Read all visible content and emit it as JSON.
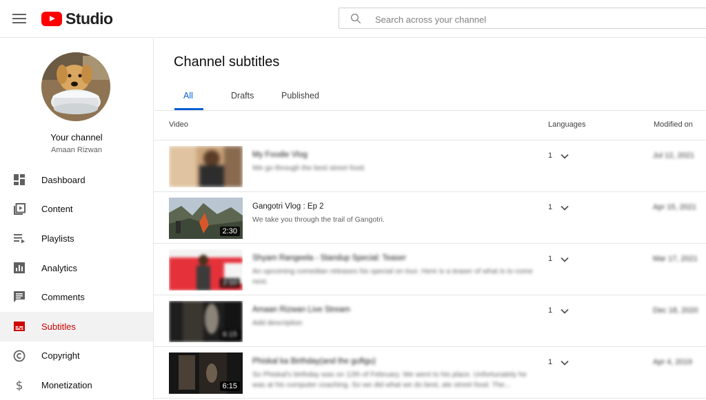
{
  "header": {
    "app_name": "Studio",
    "search_placeholder": "Search across your channel"
  },
  "sidebar": {
    "channel_title": "Your channel",
    "channel_name": "Amaan Rizwan",
    "items": [
      {
        "label": "Dashboard",
        "icon": "dashboard-icon"
      },
      {
        "label": "Content",
        "icon": "content-icon"
      },
      {
        "label": "Playlists",
        "icon": "playlists-icon"
      },
      {
        "label": "Analytics",
        "icon": "analytics-icon"
      },
      {
        "label": "Comments",
        "icon": "comments-icon"
      },
      {
        "label": "Subtitles",
        "icon": "subtitles-icon",
        "active": true
      },
      {
        "label": "Copyright",
        "icon": "copyright-icon"
      },
      {
        "label": "Monetization",
        "icon": "monetization-icon"
      }
    ]
  },
  "main": {
    "title": "Channel subtitles",
    "tabs": [
      {
        "label": "All",
        "active": true
      },
      {
        "label": "Drafts"
      },
      {
        "label": "Published"
      }
    ],
    "columns": {
      "video": "Video",
      "languages": "Languages",
      "modified": "Modified on"
    },
    "rows": [
      {
        "title": "My Foodie Vlog",
        "description": "We go through the best street food.",
        "duration": "",
        "languages": "1",
        "modified": "Jul 12, 2021",
        "blurred": true
      },
      {
        "title": "Gangotri Vlog : Ep 2",
        "description": "We take you through the trail of Gangotri.",
        "duration": "2:30",
        "languages": "1",
        "modified": "Apr 15, 2021",
        "blurred": false
      },
      {
        "title": "Shyam Rangeela - Standup Special: Teaser",
        "description": "An upcoming comedian releases his special on tour. Here is a teaser of what is to come next.",
        "duration": "2:10",
        "languages": "1",
        "modified": "Mar 17, 2021",
        "blurred": true
      },
      {
        "title": "Amaan Rizwan Live Stream",
        "description": "Add description",
        "duration": "6:15",
        "languages": "1",
        "modified": "Dec 18, 2020",
        "blurred": true
      },
      {
        "title": "Phiskal ka Birthday(and the guftgu)",
        "description": "So Phiskal's birthday was on 12th of February. We went to his place. Unfortunately he was at his computer coaching. So we did what we do best, ate street food. The...",
        "duration": "6:15",
        "languages": "1",
        "modified": "Apr 4, 2019",
        "blurred": true
      }
    ]
  },
  "colors": {
    "accent": "#065fd4",
    "brand_red": "#ff0000",
    "active_nav_text": "#cc0000"
  }
}
